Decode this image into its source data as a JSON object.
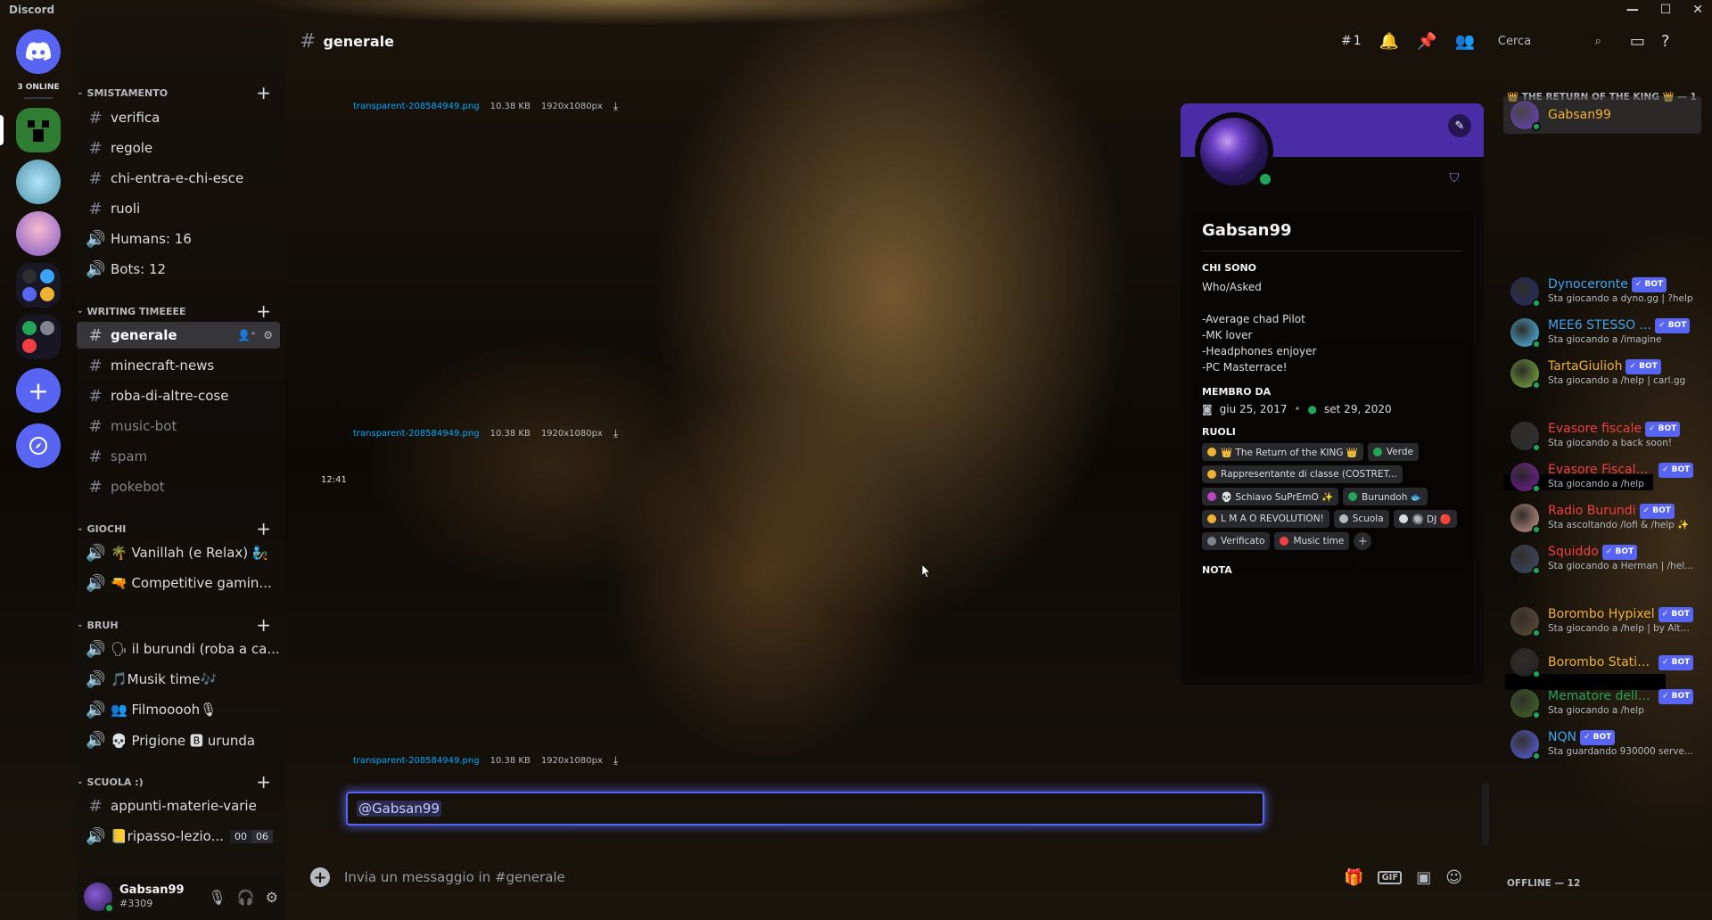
{
  "window": {
    "title": "Discord",
    "controls": {
      "minimize": "—",
      "maximize": "☐",
      "close": "✕"
    }
  },
  "rail": {
    "online_label": "3 ONLINE",
    "add_label": "+",
    "explore_label": "⊕"
  },
  "user_panel": {
    "name": "Gabsan99",
    "tag": "#3309"
  },
  "header": {
    "channel": "generale",
    "threads_count": "1",
    "search_placeholder": "Cerca"
  },
  "categories": [
    {
      "name": "SMISTAMENTO",
      "channels": [
        {
          "type": "text",
          "name": "verifica"
        },
        {
          "type": "text",
          "name": "regole"
        },
        {
          "type": "text",
          "name": "chi-entra-e-chi-esce"
        },
        {
          "type": "text",
          "name": "ruoli"
        },
        {
          "type": "voice",
          "name": "Humans: 16"
        },
        {
          "type": "voice",
          "name": "Bots: 12"
        }
      ]
    },
    {
      "name": "WRITING TIMEEEE",
      "channels": [
        {
          "type": "text",
          "name": "generale",
          "active": true
        },
        {
          "type": "text",
          "name": "minecraft-news"
        },
        {
          "type": "text",
          "name": "roba-di-altre-cose"
        },
        {
          "type": "text",
          "name": "music-bot",
          "dim": true
        },
        {
          "type": "text",
          "name": "spam",
          "dim": true
        },
        {
          "type": "text",
          "name": "pokebot",
          "dim": true
        }
      ]
    },
    {
      "name": "GIOCHI",
      "channels": [
        {
          "type": "voice",
          "name": "🌴 Vanillah (e Relax) 🧞"
        },
        {
          "type": "voice",
          "name": "🔫 Competitive gamin..."
        }
      ]
    },
    {
      "name": "BRUH",
      "channels": [
        {
          "type": "voice",
          "name": "🗣 il burundi (roba a ca..."
        },
        {
          "type": "voice",
          "name": "🎵Musik time🎶"
        },
        {
          "type": "voice",
          "name": "👥 Filmooooh🎙"
        },
        {
          "type": "voice",
          "name": "💀 Prigione 🅱 urunda"
        }
      ]
    },
    {
      "name": "SCUOLA :)",
      "channels": [
        {
          "type": "text",
          "name": "appunti-materie-varie"
        },
        {
          "type": "voice",
          "name": "📒ripasso-lezio...",
          "counts": [
            "00",
            "06"
          ]
        }
      ]
    }
  ],
  "messages": {
    "attachments": [
      {
        "filename": "transparent-208584949.png",
        "size": "10.38 KB",
        "dims": "1920x1080px"
      },
      {
        "filename": "transparent-208584949.png",
        "size": "10.38 KB",
        "dims": "1920x1080px"
      },
      {
        "filename": "transparent-208584949.png",
        "size": "10.38 KB",
        "dims": "1920x1080px"
      }
    ],
    "timestamp": "12:41",
    "mention": "@Gabsan99"
  },
  "composer": {
    "placeholder": "Invia un messaggio in #generale",
    "gif_label": "GIF"
  },
  "profile": {
    "name": "Gabsan99",
    "about_title": "CHI SONO",
    "about": "Who/Asked\n\n-Average chad Pilot\n-MK lover\n-Headphones enjoyer\n-PC Masterrace!",
    "member_since_title": "MEMBRO DA",
    "discord_since": "giu 25, 2017",
    "server_since": "set 29, 2020",
    "roles_title": "RUOLI",
    "roles": [
      {
        "name": "👑 The Return of the KING 👑",
        "color": "#f0b232"
      },
      {
        "name": "Verde",
        "color": "#23a559"
      },
      {
        "name": "Rappresentante di classe (COSTRET...",
        "color": "#f0b232"
      },
      {
        "name": "💀 Schiavo SuPrEmO ✨",
        "color": "#b845c1"
      },
      {
        "name": "Burundoh 🐟",
        "color": "#23a559"
      },
      {
        "name": "L M A O REVOLUTION!",
        "color": "#f0b232"
      },
      {
        "name": "Scuola",
        "color": "#b5bac1"
      },
      {
        "name": "🔘 DJ 🔴",
        "color": "#dbdee1"
      },
      {
        "name": "Verificato",
        "color": "#80848e"
      },
      {
        "name": "Music time",
        "color": "#f23f43"
      }
    ],
    "note_title": "NOTA"
  },
  "members": {
    "king_header": "👑 THE RETURN OF THE KING 👑 — 1",
    "offline_header": "OFFLINE — 12",
    "bot_label": "✓ BOT",
    "list": [
      {
        "name": "Gabsan99",
        "status": "",
        "color": "#f0b232",
        "bot": false,
        "avatar": "#6a3fc5"
      },
      {
        "name": "Dynoceronte",
        "status": "Sta giocando a dyno.gg | ?help",
        "color": "#3ba5f5",
        "bot": true,
        "avatar": "#1f2a6b"
      },
      {
        "name": "MEE6 STESSO ...",
        "status": "Sta giocando a /imagine",
        "color": "#3ba5f5",
        "bot": true,
        "avatar": "#4fc3f7"
      },
      {
        "name": "TartaGiulioh",
        "status": "Sta giocando a /help | carl.gg",
        "color": "#f0b232",
        "bot": true,
        "avatar": "#7cb342"
      },
      {
        "name": "Evasore fiscale",
        "status": "Sta giocando a back soon!",
        "color": "#f23f43",
        "bot": true,
        "avatar": "#2b2d31"
      },
      {
        "name": "Evasore Fiscale ...",
        "status": "Sta giocando a /help",
        "color": "#f23f43",
        "bot": true,
        "avatar": "#7b1fa2"
      },
      {
        "name": "Radio Burundi",
        "status": "Sta ascoltando /lofi & /help ✨",
        "color": "#f23f43",
        "bot": true,
        "avatar": "#c99a8a"
      },
      {
        "name": "Squiddo",
        "status": "Sta giocando a Herman | /hel...",
        "color": "#f23f43",
        "bot": true,
        "avatar": "#3a4a6b"
      },
      {
        "name": "Borombo Hypixel",
        "status": "Sta giocando a /help | by Altp...",
        "color": "#f0b232",
        "bot": true,
        "avatar": "#5d4c38"
      },
      {
        "name": "Borombo Statis...",
        "status": "",
        "color": "#f0b232",
        "bot": true,
        "avatar": "#1e1f22"
      },
      {
        "name": "Mematore della...",
        "status": "Sta giocando a /help",
        "color": "#23a559",
        "bot": true,
        "avatar": "#3f6b2a"
      },
      {
        "name": "NQN",
        "status": "Sta guardando 930000 serve...",
        "color": "#3ba5f5",
        "bot": true,
        "avatar": "#5865f2"
      }
    ]
  }
}
